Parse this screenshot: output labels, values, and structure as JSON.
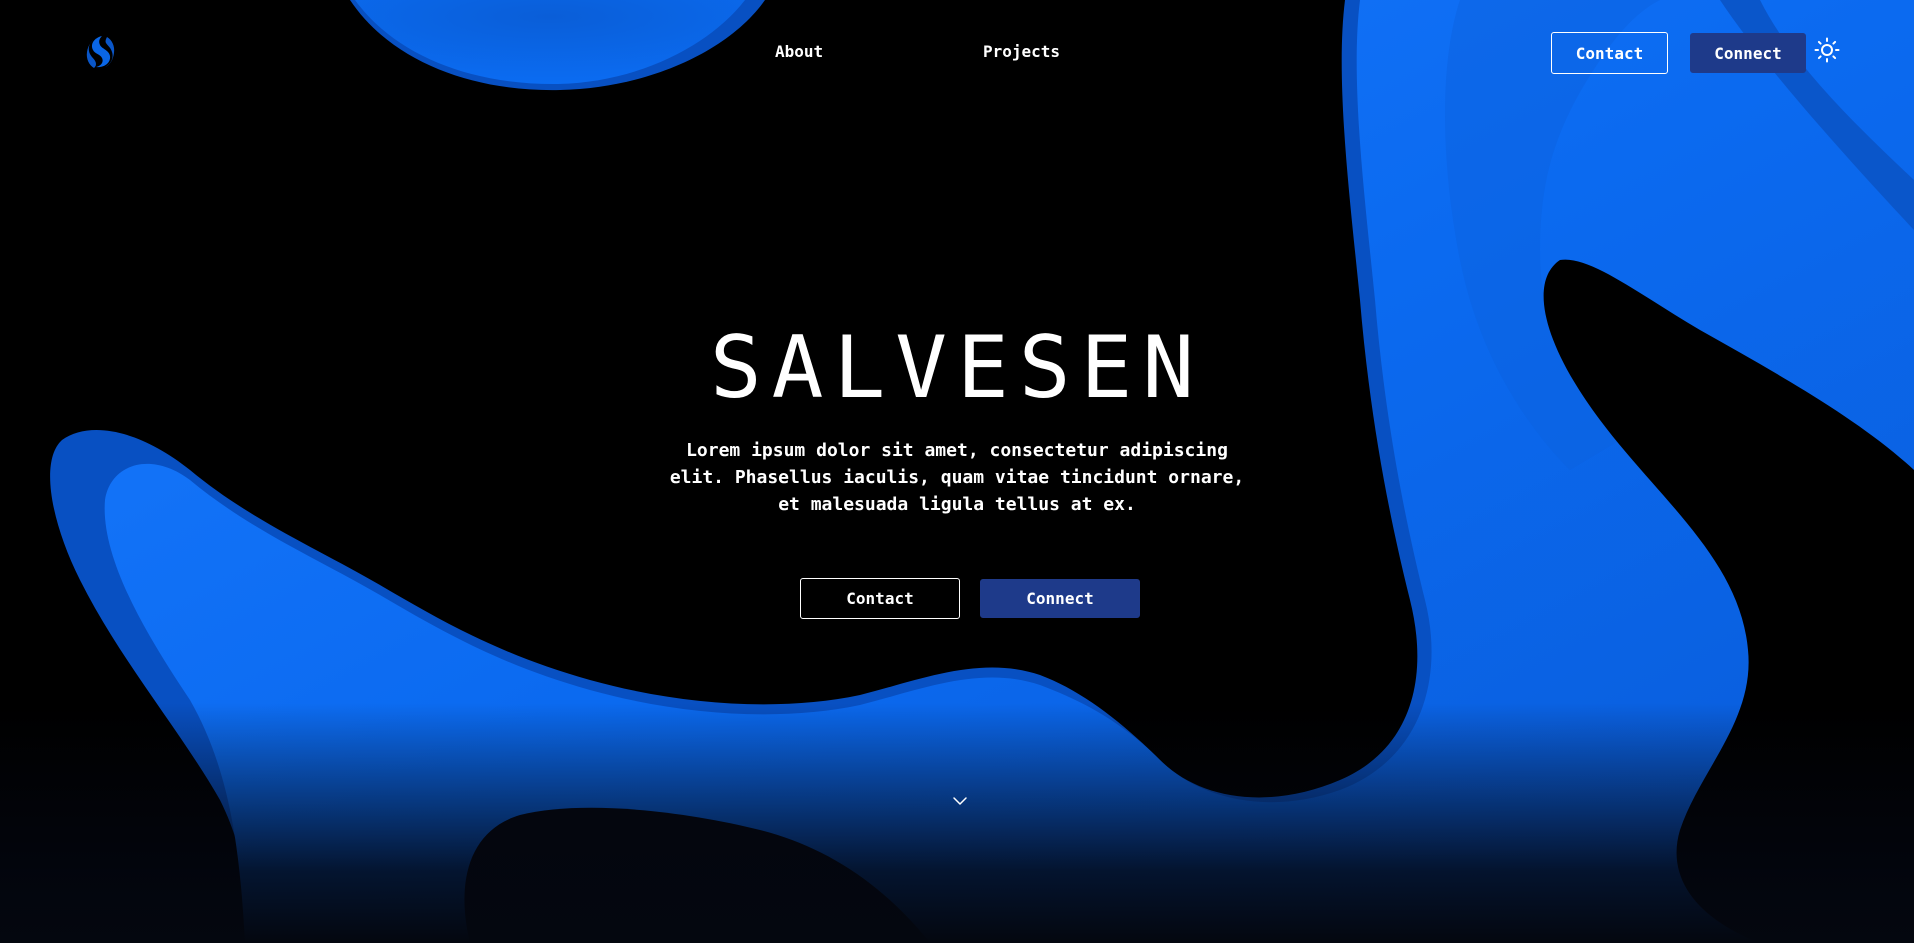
{
  "brand": {
    "logo_icon": "s-swirl-logo-icon",
    "accent_color": "#0a66e6",
    "button_color": "#1e3a8a"
  },
  "nav": {
    "links": [
      {
        "label": "About"
      },
      {
        "label": "Projects"
      }
    ],
    "contact_label": "Contact",
    "connect_label": "Connect",
    "theme_icon": "sun-icon"
  },
  "hero": {
    "title": "SALVESEN",
    "description": "Lorem ipsum dolor sit amet, consectetur adipiscing elit. Phasellus iaculis, quam vitae tincidunt ornare, et malesuada ligula tellus at ex.",
    "contact_label": "Contact",
    "connect_label": "Connect",
    "scroll_icon": "chevron-down-icon"
  }
}
